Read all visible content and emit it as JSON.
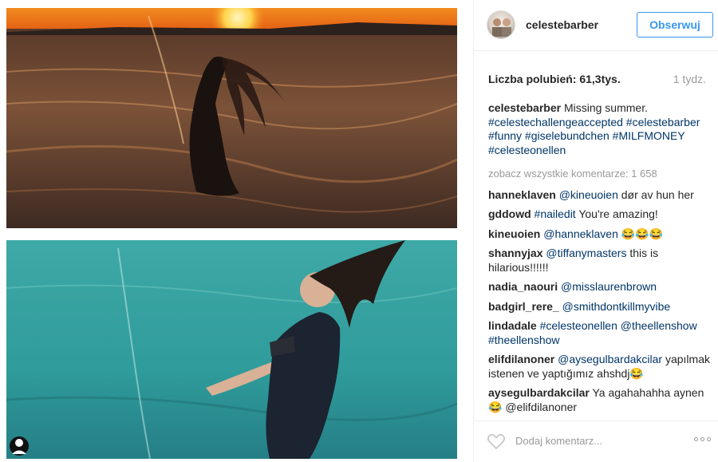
{
  "post": {
    "username": "celestebarber",
    "follow_label": "Obserwuj",
    "likes_text": "Liczba polubień: 61,3tys.",
    "time_ago": "1 tydz.",
    "caption": {
      "user": "celestebarber",
      "text": "Missing summer.",
      "tags": "#celestechallengeaccepted #celestebarber #funny #giselebundchen #MILFMONEY #celesteonellen"
    },
    "view_all": "zobacz wszystkie komentarze: 1 658",
    "comments": [
      {
        "user": "hanneklaven",
        "mention": "@kineuoien",
        "text": "dør av hun her"
      },
      {
        "user": "gddowd",
        "mention": "#nailedit",
        "text": "You're amazing!"
      },
      {
        "user": "kineuoien",
        "mention": "@hanneklaven",
        "text": "😂😂😂"
      },
      {
        "user": "shannyjax",
        "mention": "@tiffanymasters",
        "text": "this is hilarious!!!!!!"
      },
      {
        "user": "nadia_naouri",
        "mention": "@misslaurenbrown",
        "text": ""
      },
      {
        "user": "badgirl_rere_",
        "mention": "@smithdontkillmyvibe",
        "text": ""
      },
      {
        "user": "lindadale",
        "mention": "#celesteonellen @theellenshow #theellenshow",
        "text": ""
      },
      {
        "user": "elifdilanoner",
        "mention": "@aysegulbardakcilar",
        "text": "yapılmak istenen ve yaptığımız ahshdj😂"
      },
      {
        "user": "aysegulbardakcilar",
        "mention": "",
        "text": "Ya agahahahha aynen 😂 @elifdilanoner"
      }
    ],
    "add_comment_placeholder": "Dodaj komentarz..."
  },
  "icons": {
    "heart": "heart-icon",
    "more": "more-options-icon",
    "user_tag": "user-tag-icon"
  },
  "colors": {
    "accent": "#3897f0",
    "hashtag": "#003569",
    "muted": "#999999"
  }
}
